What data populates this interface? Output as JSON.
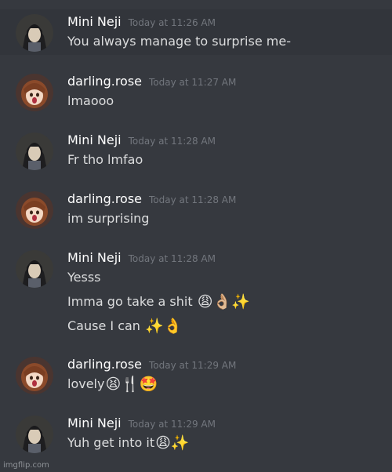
{
  "messages": [
    {
      "author": "Mini Neji",
      "avatar_icon": "mini-neji-avatar-icon",
      "timestamp": "Today at 11:26 AM",
      "lines": [
        {
          "text": "You always manage to surprise me-",
          "emoji": ""
        }
      ]
    },
    {
      "author": "darling.rose",
      "avatar_icon": "darling-rose-avatar-icon",
      "timestamp": "Today at 11:27 AM",
      "lines": [
        {
          "text": "lmaooo",
          "emoji": ""
        }
      ]
    },
    {
      "author": "Mini Neji",
      "avatar_icon": "mini-neji-avatar-icon",
      "timestamp": "Today at 11:28 AM",
      "lines": [
        {
          "text": "Fr tho lmfao",
          "emoji": ""
        }
      ]
    },
    {
      "author": "darling.rose",
      "avatar_icon": "darling-rose-avatar-icon",
      "timestamp": "Today at 11:28 AM",
      "lines": [
        {
          "text": "im surprising",
          "emoji": ""
        }
      ]
    },
    {
      "author": "Mini Neji",
      "avatar_icon": "mini-neji-avatar-icon",
      "timestamp": "Today at 11:28 AM",
      "lines": [
        {
          "text": "Yesss",
          "emoji": ""
        },
        {
          "text": "Imma go take a shit ",
          "emoji": "😩👌🏼✨"
        },
        {
          "text": "Cause I can ",
          "emoji": "✨👌"
        }
      ]
    },
    {
      "author": "darling.rose",
      "avatar_icon": "darling-rose-avatar-icon",
      "timestamp": "Today at 11:29 AM",
      "lines": [
        {
          "text": "lovely",
          "emoji": "😫🍴🤩"
        }
      ]
    },
    {
      "author": "Mini Neji",
      "avatar_icon": "mini-neji-avatar-icon",
      "timestamp": "Today at 11:29 AM",
      "lines": [
        {
          "text": "Yuh get into it",
          "emoji": "😩✨"
        }
      ]
    }
  ],
  "watermark": "imgflip.com",
  "colors": {
    "background": "#36393f",
    "highlight": "#32353b",
    "username": "#ffffff",
    "timestamp": "#72767d",
    "message_text": "#dcddde"
  }
}
